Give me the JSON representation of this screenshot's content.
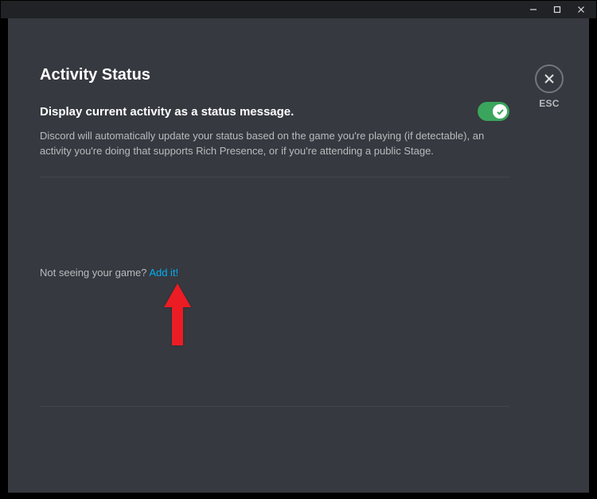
{
  "page": {
    "title": "Activity Status"
  },
  "setting": {
    "label": "Display current activity as a status message.",
    "description": "Discord will automatically update your status based on the game you're playing (if detectable), an activity you're doing that supports Rich Presence, or if you're attending a public Stage.",
    "enabled": true
  },
  "addGame": {
    "prompt": "Not seeing your game? ",
    "link": "Add it!"
  },
  "close": {
    "label": "ESC"
  }
}
